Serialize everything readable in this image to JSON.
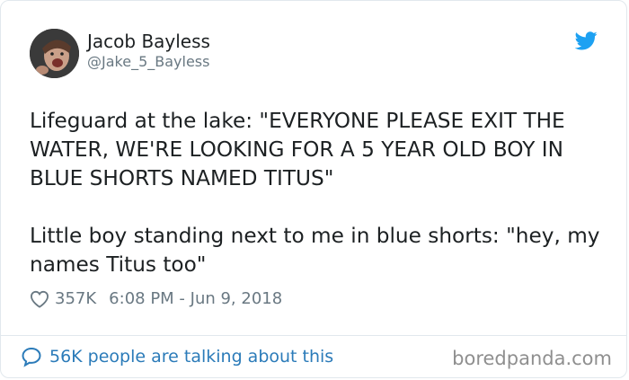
{
  "author": {
    "name": "Jacob Bayless",
    "handle": "@Jake_5_Bayless"
  },
  "tweet": {
    "paragraph1": "Lifeguard at the lake: \"EVERYONE PLEASE EXIT THE WATER, WE'RE LOOKING FOR A 5 YEAR OLD BOY IN BLUE SHORTS NAMED TITUS\"",
    "paragraph2": "Little boy standing next to me in blue shorts: \"hey, my names Titus too\""
  },
  "meta": {
    "likes": "357K",
    "timestamp": "6:08 PM - Jun 9, 2018"
  },
  "footer": {
    "talking": "56K people are talking about this",
    "watermark": "boredpanda.com"
  },
  "icons": {
    "brand": "twitter-bird-icon",
    "like": "heart-icon",
    "reply": "speech-bubble-icon"
  },
  "colors": {
    "twitter_blue": "#1da1f2",
    "link_blue": "#2b7bb9",
    "muted": "#697882",
    "text": "#1c2022"
  }
}
